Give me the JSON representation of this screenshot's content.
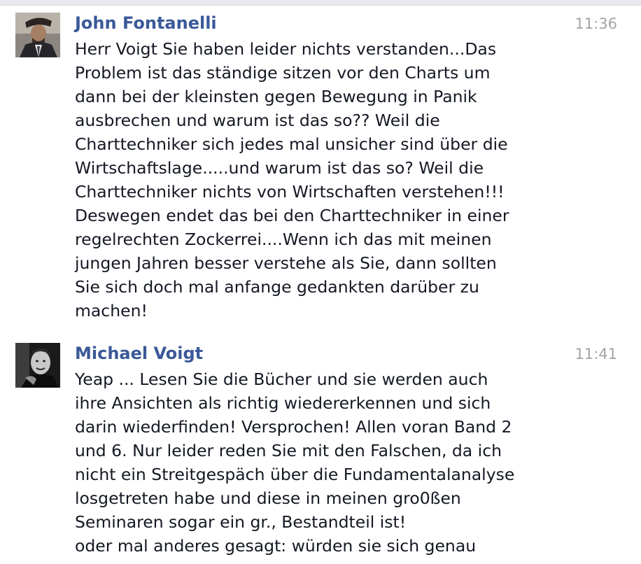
{
  "messages": [
    {
      "author": "John Fontanelli",
      "time": "11:36",
      "avatar": "man-in-suit-with-hat-avatar",
      "lines": [
        "Herr Voigt Sie haben leider nichts verstanden...Das",
        "Problem ist das ständige sitzen vor den Charts um",
        "dann bei der kleinsten gegen Bewegung in Panik",
        "ausbrechen und warum ist das so?? Weil die",
        "Charttechniker sich jedes mal unsicher sind über die",
        "Wirtschaftslage.....und warum ist das so? Weil die",
        "Charttechniker nichts von Wirtschaften verstehen!!!",
        "Deswegen endet das bei den Charttechniker in einer",
        "regelrechten Zockerrei....Wenn ich das mit meinen",
        "jungen Jahren besser verstehe als Sie, dann sollten",
        "Sie sich doch mal anfange gedankten darüber zu",
        "machen!"
      ]
    },
    {
      "author": "Michael Voigt",
      "time": "11:41",
      "avatar": "man-black-and-white-portrait-avatar",
      "lines": [
        "Yeap ... Lesen Sie die Bücher und sie werden auch",
        "ihre Ansichten als richtig wiedererkennen und sich",
        "darin wiederfinden! Versprochen! Allen voran Band 2",
        "und 6. Nur leider reden Sie mit den Falschen, da ich",
        "nicht ein Streitgespäch über die Fundamentalanalyse",
        "losgetreten habe und diese in meinen gro0ßen",
        "Seminaren sogar ein gr., Bestandteil ist!",
        "oder mal anderes gesagt: würden sie sich genau"
      ]
    }
  ],
  "colors": {
    "author": "#3b5998",
    "timestamp": "#a4a4a4",
    "text": "#141823"
  }
}
